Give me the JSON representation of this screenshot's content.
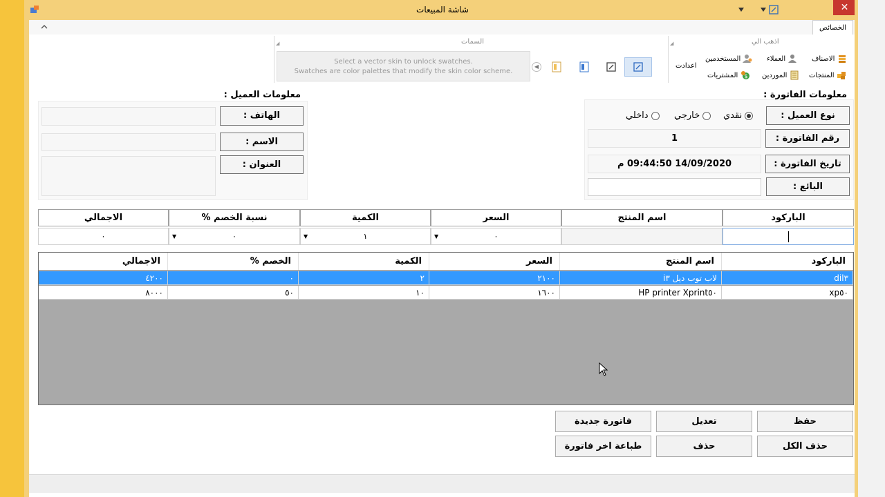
{
  "window": {
    "title": "شاشة المبيعات"
  },
  "ribbon": {
    "tab_label": "الخصائص",
    "goto_group": "اذهب الي",
    "skins_group": "السمات",
    "items": {
      "categories": "الاصناف",
      "customers": "العملاء",
      "users": "المستخدمين",
      "settings": "اعدادت",
      "products": "المنتجات",
      "suppliers": "الموردين",
      "purchases": "المشتريات"
    },
    "swatch_line1": "Select a vector skin to unlock swatches.",
    "swatch_line2": "Swatches are color palettes that modify the skin color scheme."
  },
  "invoice": {
    "section_title": "معلومات الفاتورة :",
    "customer_type_label": "نوع العميل :",
    "radio_cash": "نقدي",
    "radio_external": "خارجي",
    "radio_internal": "داخلي",
    "invoice_no_label": "رقم الفاتورة :",
    "invoice_no_value": "1",
    "invoice_date_label": "تاريخ الفاتورة :",
    "invoice_date_value": "14/09/2020  09:44:50 م",
    "seller_label": "البائع :",
    "seller_value": ""
  },
  "customer": {
    "section_title": "معلومات العميل :",
    "phone_label": "الهاتف :",
    "name_label": "الاسم :",
    "address_label": "العنوان :"
  },
  "entry": {
    "headers": {
      "barcode": "الباركود",
      "product_name": "اسم المنتج",
      "price": "السعر",
      "quantity": "الكمية",
      "discount": "نسبة الخصم %",
      "total": "الاجمالي"
    },
    "values": {
      "barcode": "",
      "product_name": "",
      "price": "٠",
      "quantity": "١",
      "discount": "٠",
      "total": "٠"
    }
  },
  "grid": {
    "columns": {
      "barcode": "الباركود",
      "product_name": "اسم المنتج",
      "price": "السعر",
      "quantity": "الكمية",
      "discount": "الخصم %",
      "total": "الاجمالي"
    },
    "rows": [
      {
        "barcode": "dil٣",
        "product_name": "لاب توب ديل i٣",
        "price": "٢١٠٠",
        "quantity": "٢",
        "discount": "٠",
        "total": "٤٢٠٠"
      },
      {
        "barcode": "xp٥٠",
        "product_name": "printer Xprint٥٠ HP",
        "price": "١٦٠٠",
        "quantity": "١٠",
        "discount": "٥٠",
        "total": "٨٠٠٠"
      }
    ]
  },
  "buttons": {
    "save": "حفظ",
    "edit": "تعديل",
    "new_invoice": "فاتورة جديدة",
    "delete_all": "حذف الكل",
    "delete": "حذف",
    "print_last": "طباعة اخر فاتورة"
  },
  "colors": {
    "title_bar": "#f4d07a",
    "selection": "#3399ff",
    "close": "#c7372f"
  }
}
